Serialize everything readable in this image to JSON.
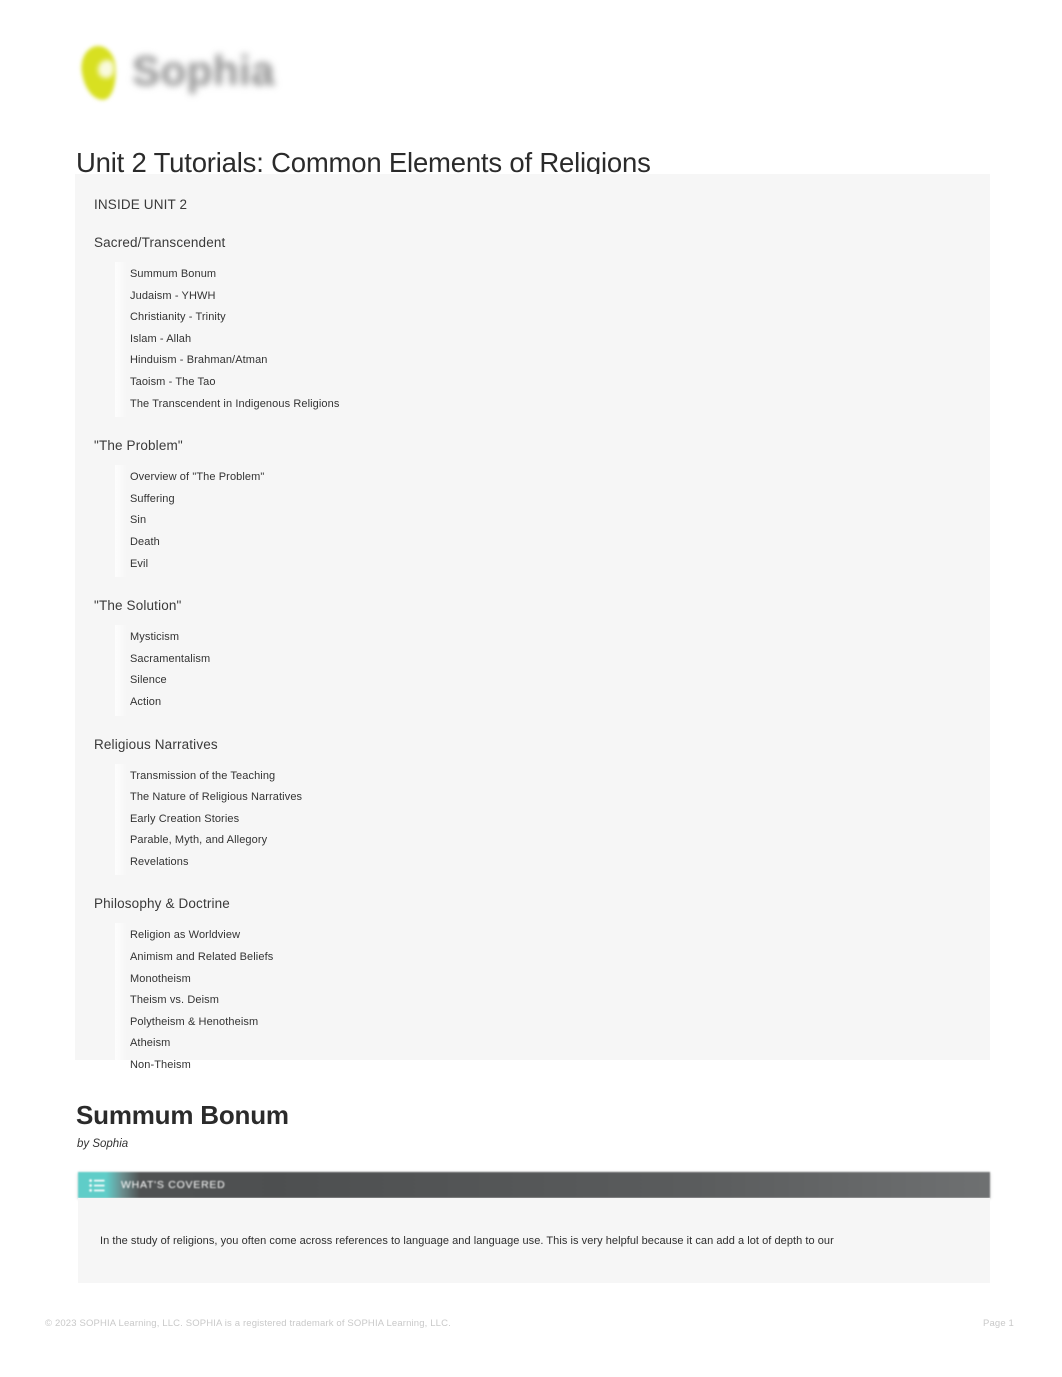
{
  "header": {
    "logo_mark": "sophia-leaf-logo",
    "logo_wordmark": "Sophia",
    "page_title": "Unit 2 Tutorials: Common Elements of Religions"
  },
  "toc": {
    "kicker": "INSIDE UNIT 2",
    "sections": [
      {
        "title": "Sacred/Transcendent",
        "items": [
          "Summum Bonum",
          "Judaism - YHWH",
          "Christianity - Trinity",
          "Islam - Allah",
          "Hinduism - Brahman/Atman",
          "Taoism - The Tao",
          "The Transcendent in Indigenous Religions"
        ]
      },
      {
        "title": "\"The Problem\"",
        "items": [
          "Overview of \"The Problem\"",
          "Suffering",
          "Sin",
          "Death",
          "Evil"
        ]
      },
      {
        "title": "\"The Solution\"",
        "items": [
          "Mysticism",
          "Sacramentalism",
          "Silence",
          "Action"
        ]
      },
      {
        "title": "Religious Narratives",
        "items": [
          "Transmission of the Teaching",
          "The Nature of Religious Narratives",
          "Early Creation Stories",
          "Parable, Myth, and Allegory",
          "Revelations"
        ]
      },
      {
        "title": "Philosophy & Doctrine",
        "items": [
          "Religion as Worldview",
          "Animism and Related Beliefs",
          "Monotheism",
          "Theism vs. Deism",
          "Polytheism & Henotheism",
          "Atheism",
          "Non-Theism"
        ]
      }
    ]
  },
  "tutorial": {
    "title": "Summum Bonum",
    "byline": "by Sophia",
    "banner": {
      "icon": "list-icon",
      "label": "WHAT'S COVERED",
      "accent_color": "#5fcdc8",
      "bar_color": "#4d4f50"
    },
    "paragraph": "In the study of religions, you often come across references to language and language use. This is very helpful because it can add a lot of depth to our"
  },
  "footer": {
    "copyright": "© 2023 SOPHIA Learning, LLC. SOPHIA is a registered trademark of SOPHIA Learning, LLC.",
    "page_number": "Page 1"
  }
}
